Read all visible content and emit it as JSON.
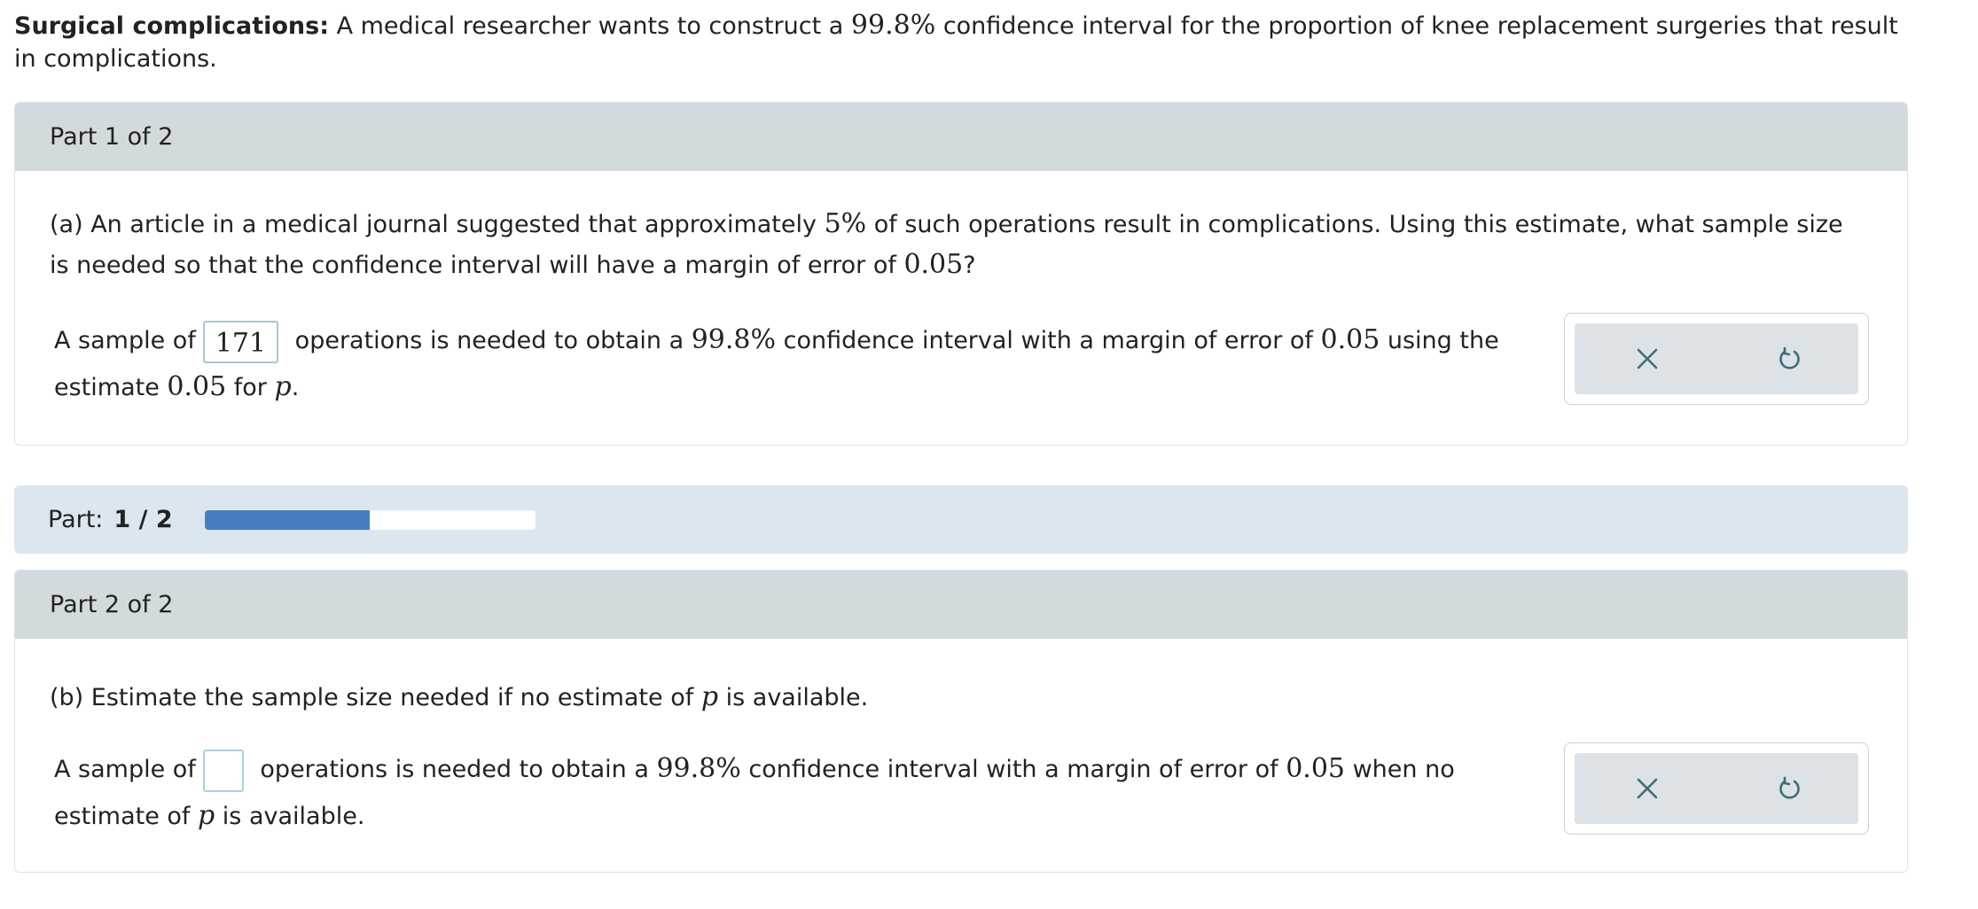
{
  "intro": {
    "title": "Surgical complications:",
    "text_before": " A medical researcher wants to construct a ",
    "confidence": "99.8%",
    "text_after": " confidence interval for the proportion of knee replacement surgeries that result in complications."
  },
  "part1": {
    "header": "Part 1 of 2",
    "question_a": "(a) An article in a medical journal suggested that approximately ",
    "question_pct": "5%",
    "question_b": " of such operations result in complications. Using this estimate, what sample size is needed so that the confidence interval will have a margin of error of ",
    "question_moe": "0.05",
    "question_end": "?",
    "answer_prefix": "A sample of",
    "answer_value": "171",
    "answer_mid": " operations is needed to obtain a ",
    "answer_conf": "99.8%",
    "answer_mid2": " confidence interval with a margin of error of ",
    "answer_moe": "0.05",
    "answer_mid3": " using the estimate ",
    "answer_est": "0.05",
    "answer_mid4": " for ",
    "answer_p": "p",
    "answer_end": "."
  },
  "progress": {
    "label": "Part:",
    "value": "1 / 2",
    "fraction": 0.5
  },
  "part2": {
    "header": "Part 2 of 2",
    "question_a": "(b) Estimate the sample size needed if no estimate of ",
    "question_p": "p",
    "question_end": " is available.",
    "answer_prefix": "A sample of",
    "answer_value": "",
    "answer_mid": " operations is needed to obtain a ",
    "answer_conf": "99.8%",
    "answer_mid2": " confidence interval with a margin of error of ",
    "answer_moe": "0.05",
    "answer_mid3": " when no estimate of ",
    "answer_p": "p",
    "answer_end": " is available."
  },
  "icons": {
    "clear": "close-icon",
    "undo": "undo-icon"
  },
  "colors": {
    "panel_header": "#d3dadd",
    "progress_strip": "#dbe6ef",
    "progress_fill": "#4a7dbf",
    "toolbar_bg": "#dce2e6",
    "icon": "#3c6e78"
  }
}
